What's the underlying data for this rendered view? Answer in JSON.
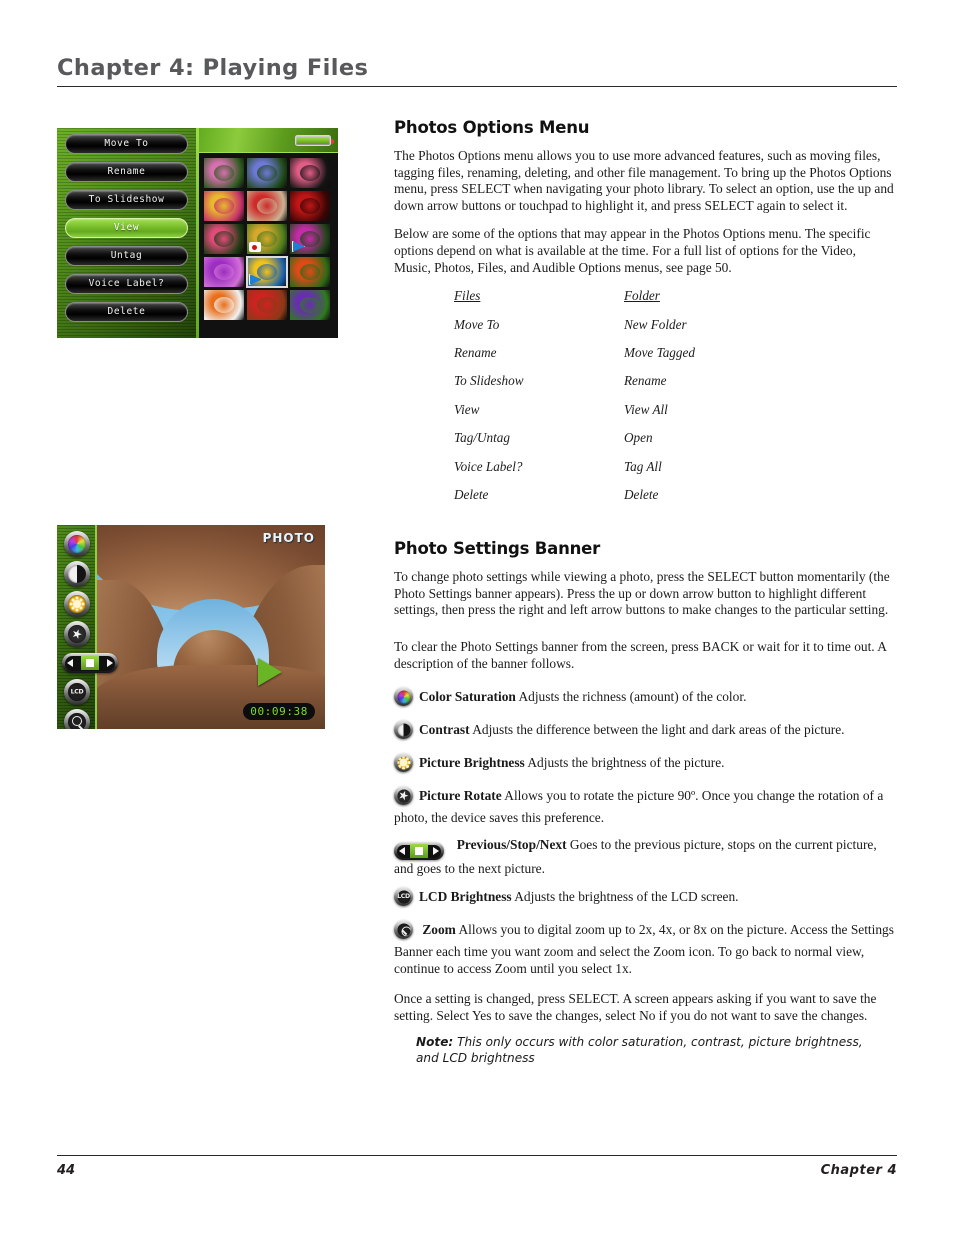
{
  "header": {
    "chapter_title": "Chapter 4: Playing Files"
  },
  "footer": {
    "page_number": "44",
    "chapter_label": "Chapter  4"
  },
  "sections": {
    "photos_options": {
      "heading": "Photos Options Menu",
      "para1": "The Photos Options menu allows you to use more advanced features, such as moving files, tagging files, renaming, deleting, and other file management. To bring up the Photos Options menu, press SELECT when navigating your photo library. To select an option, use the up and down arrow buttons or touchpad to highlight it, and press SELECT again to select it.",
      "para2": "Below are some of the options that may appear in the Photos Options menu.  The specific options depend on what is available at the time. For a full list of options for the Video, Music, Photos, Files, and Audible Options menus, see page 50."
    },
    "options_table": {
      "col_a_header": "Files",
      "col_b_header": "Folder",
      "rows": [
        {
          "files": "Move To",
          "folder": "New Folder"
        },
        {
          "files": "Rename",
          "folder": "Move Tagged"
        },
        {
          "files": "To Slideshow",
          "folder": "Rename"
        },
        {
          "files": "View",
          "folder": "View All"
        },
        {
          "files": "Tag/Untag",
          "folder": "Open"
        },
        {
          "files": "Voice Label?",
          "folder": "Tag All"
        },
        {
          "files": "Delete",
          "folder": "Delete"
        }
      ]
    },
    "photo_settings": {
      "heading": "Photo Settings Banner",
      "para1": "To change photo settings while viewing a photo, press the SELECT button momentarily (the Photo Settings banner appears). Press the up or down arrow button to highlight different settings, then press the right and left arrow buttons to make changes to the particular setting.",
      "para2": "To clear the Photo Settings banner from the screen, press BACK or wait for it to time out. A description of the banner follows.",
      "items": [
        {
          "icon": "color-saturation-icon",
          "label": "Color Saturation",
          "desc": " Adjusts the richness (amount) of the color."
        },
        {
          "icon": "contrast-icon",
          "label": "Contrast",
          "desc": " Adjusts the difference between the light and dark areas of the picture."
        },
        {
          "icon": "picture-brightness-icon",
          "label": "Picture Brightness",
          "desc": " Adjusts the brightness of the picture."
        },
        {
          "icon": "picture-rotate-icon",
          "label": "Picture Rotate",
          "desc": "  Allows you to rotate the picture 90º. Once you change the rotation of a photo, the device saves this preference."
        },
        {
          "icon": "previous-stop-next-icon",
          "label": "Previous/Stop/Next",
          "desc": " Goes to the previous picture, stops on the current picture, and goes to the next picture."
        },
        {
          "icon": "lcd-brightness-icon",
          "label": "LCD Brightness",
          "desc": "  Adjusts the brightness of the LCD screen."
        },
        {
          "icon": "zoom-icon",
          "label": "Zoom",
          "desc": "  Allows you to digital zoom up to 2x, 4x, or 8x on the picture. Access the Settings Banner each time you want zoom and select the Zoom icon. To go back to normal view, continue to access Zoom until you select 1x."
        }
      ],
      "closing": "Once a setting is changed, press SELECT. A screen appears asking if you want to save the setting. Select Yes to save the changes, select No if you do not want to save the changes.",
      "note_label": "Note:",
      "note_text": " This only occurs with color saturation, contrast, picture brightness, and LCD brightness"
    }
  },
  "device_menu_screenshot": {
    "buttons": [
      {
        "label": "Move To",
        "active": false
      },
      {
        "label": "Rename",
        "active": false
      },
      {
        "label": "To Slideshow",
        "active": false
      },
      {
        "label": "View",
        "active": true
      },
      {
        "label": "Untag",
        "active": false
      },
      {
        "label": "Voice Label?",
        "active": false
      },
      {
        "label": "Delete",
        "active": false
      }
    ],
    "battery_icon": "battery-icon",
    "thumbnails": [
      {
        "name": "pink-lotus",
        "c1": "#d86fb0",
        "c2": "#2d5c1e",
        "selected": false,
        "badge": ""
      },
      {
        "name": "blue-forget-me-not",
        "c1": "#6f78d8",
        "c2": "#1f4a18",
        "selected": false,
        "badge": ""
      },
      {
        "name": "pink-blossoms",
        "c1": "#e05d86",
        "c2": "#141414",
        "selected": false,
        "badge": ""
      },
      {
        "name": "yellow-pink-daisies",
        "c1": "#e8b92c",
        "c2": "#c7316a",
        "selected": false,
        "badge": ""
      },
      {
        "name": "red-tulips",
        "c1": "#cf2a2a",
        "c2": "#cbb392",
        "selected": false,
        "badge": ""
      },
      {
        "name": "red-rose",
        "c1": "#c01616",
        "c2": "#3a0505",
        "selected": false,
        "badge": ""
      },
      {
        "name": "pink-lily",
        "c1": "#e24a7a",
        "c2": "#1e3d14",
        "selected": false,
        "badge": ""
      },
      {
        "name": "mixed-wildflowers",
        "c1": "#d8a82c",
        "c2": "#4a7a1e",
        "selected": false,
        "badge": "voice"
      },
      {
        "name": "magenta-orchid",
        "c1": "#c52ba8",
        "c2": "#1f4418",
        "selected": false,
        "badge": "tag"
      },
      {
        "name": "purple-azalea",
        "c1": "#9b2fc0",
        "c2": "#d36fd8",
        "selected": false,
        "badge": ""
      },
      {
        "name": "yellow-sunflower",
        "c1": "#f0c21a",
        "c2": "#1b5fb0",
        "selected": true,
        "badge": "tag"
      },
      {
        "name": "orange-red-blooms",
        "c1": "#e04a18",
        "c2": "#2f6a16",
        "selected": false,
        "badge": ""
      },
      {
        "name": "orange-tiger-lily",
        "c1": "#e8701c",
        "c2": "#f2f2f2",
        "selected": false,
        "badge": ""
      },
      {
        "name": "red-flower-field",
        "c1": "#cf2222",
        "c2": "#8a3a16",
        "selected": false,
        "badge": ""
      },
      {
        "name": "purple-iris",
        "c1": "#6a2bb5",
        "c2": "#2f7a1e",
        "selected": false,
        "badge": ""
      }
    ]
  },
  "device_photo_screenshot": {
    "label": "PHOTO",
    "timestamp": "00:09:38",
    "play_icon": "play-icon",
    "rail_icons": [
      "color-saturation-icon",
      "contrast-icon",
      "picture-brightness-icon",
      "picture-rotate-icon",
      "previous-stop-next-icon",
      "lcd-brightness-icon",
      "zoom-icon"
    ]
  },
  "colors": {
    "header_gray": "#58595b",
    "menu_green": "#6ab024",
    "highlight_green": "#7cc22e",
    "lcd_green": "#7ddc2a"
  }
}
